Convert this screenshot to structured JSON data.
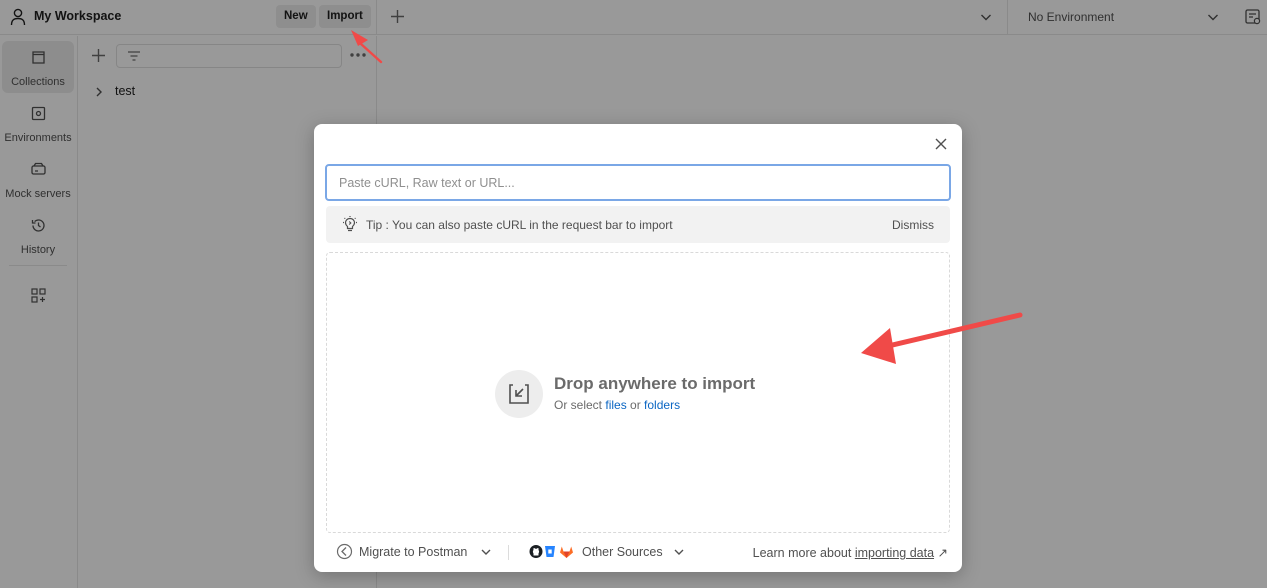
{
  "header": {
    "workspace_title": "My Workspace",
    "new_label": "New",
    "import_label": "Import",
    "environment_label": "No Environment"
  },
  "sidebar": {
    "items": [
      {
        "label": "Collections",
        "icon": "collections-icon",
        "active": true
      },
      {
        "label": "Environments",
        "icon": "environments-icon",
        "active": false
      },
      {
        "label": "Mock servers",
        "icon": "mock-servers-icon",
        "active": false
      },
      {
        "label": "History",
        "icon": "history-icon",
        "active": false
      }
    ]
  },
  "collections": {
    "items": [
      {
        "name": "test"
      }
    ]
  },
  "import_modal": {
    "input_placeholder": "Paste cURL, Raw text or URL...",
    "tip_text": "Tip : You can also paste cURL in the request bar to import",
    "dismiss_label": "Dismiss",
    "drop_title": "Drop anywhere to import",
    "drop_sub_prefix": "Or select ",
    "files_link": "files",
    "drop_sub_or": " or ",
    "folders_link": "folders",
    "migrate_label": "Migrate to Postman",
    "other_sources_label": "Other Sources",
    "learn_prefix": "Learn more about ",
    "learn_link": "importing data",
    "learn_arrow": "↗"
  },
  "colors": {
    "annotation_arrow": "#f04a48",
    "link": "#0b66c3",
    "input_focus": "#7aa7e6"
  }
}
